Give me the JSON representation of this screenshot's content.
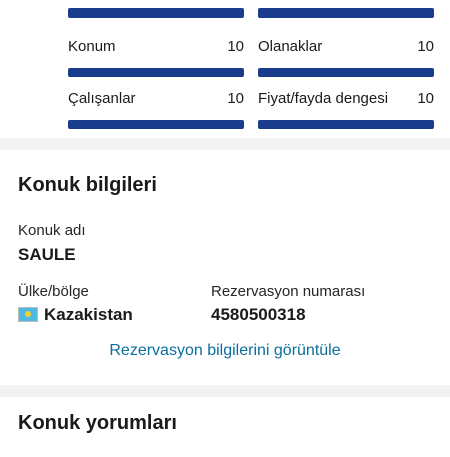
{
  "scores": {
    "items": [
      {
        "label": "Konum",
        "value": "10"
      },
      {
        "label": "Olanaklar",
        "value": "10"
      },
      {
        "label": "Çalışanlar",
        "value": "10"
      },
      {
        "label": "Fiyat/fayda dengesi",
        "value": "10"
      }
    ],
    "bar_fraction": 1.0,
    "bar_color": "#1a3c8c"
  },
  "guest": {
    "title": "Konuk bilgileri",
    "name_label": "Konuk adı",
    "name_value": "SAULE",
    "country_label": "Ülke/bölge",
    "country_value": "Kazakistan",
    "country_flag_icon": "kazakhstan-flag-icon",
    "reservation_label": "Rezervasyon numarası",
    "reservation_value": "4580500318",
    "view_link": "Rezervasyon bilgilerini görüntüle",
    "link_color": "#0a6e9e"
  },
  "reviews": {
    "title": "Konuk yorumları"
  }
}
